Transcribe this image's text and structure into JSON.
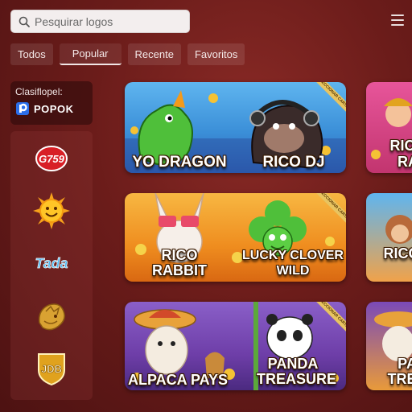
{
  "search": {
    "placeholder": "Pesquirar logos"
  },
  "tabs": [
    {
      "label": "Todos"
    },
    {
      "label": "Popular"
    },
    {
      "label": "Recente"
    },
    {
      "label": "Favoritos"
    }
  ],
  "provider_card": {
    "label": "Clasiflopel:",
    "name": "POPOK"
  },
  "providers": [
    {
      "name": "G759"
    },
    {
      "name": "sun-logo"
    },
    {
      "name": "Tada"
    },
    {
      "name": "dragon-logo"
    },
    {
      "name": "JDB"
    }
  ],
  "games": [
    {
      "title_1": "YO DRAGON",
      "title_2": "RICO DJ",
      "ribbon": "COLECCIONAR CARTA"
    },
    {
      "title": "RICO RA"
    },
    {
      "title_1": "RICO RABBIT",
      "title_2": "LUCKY CLOVER WILD",
      "ribbon": "COLECCIONAR CARTA"
    },
    {
      "title": "RICO"
    },
    {
      "title_1": "ALPACA PAYS",
      "title_2": "PANDA TREASURE",
      "ribbon": "COLECCIONAR CARTA"
    },
    {
      "title": "PA TREA"
    }
  ],
  "colors": {
    "background": "#6b1c1a",
    "accent": "#e8c460"
  }
}
